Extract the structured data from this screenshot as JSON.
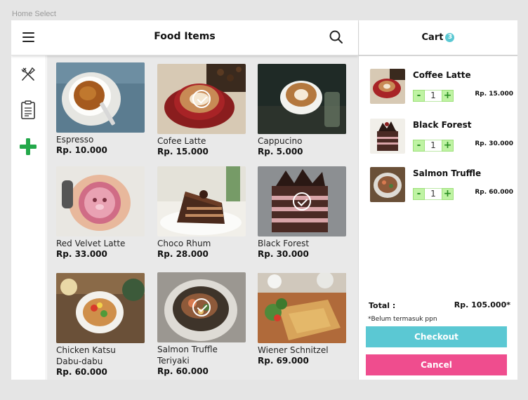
{
  "frame_label": "Home Select",
  "header": {
    "title": "Food Items"
  },
  "sidebar": {
    "items": [
      "utensils-icon",
      "menu-list-icon",
      "add-icon"
    ],
    "accent": "#23a84a"
  },
  "items": [
    {
      "name": "Espresso",
      "price": "Rp. 10.000",
      "selected": false
    },
    {
      "name": "Cofee Latte",
      "price": "Rp. 15.000",
      "selected": true
    },
    {
      "name": "Cappucino",
      "price": "Rp. 5.000",
      "selected": false
    },
    {
      "name": "Red Velvet Latte",
      "price": "Rp. 33.000",
      "selected": false
    },
    {
      "name": "Choco Rhum",
      "price": "Rp. 28.000",
      "selected": false
    },
    {
      "name": "Black Forest",
      "price": "Rp. 30.000",
      "selected": true
    },
    {
      "name": "Chicken Katsu Dabu-dabu",
      "name_lines": [
        "Chicken Katsu",
        "Dabu-dabu"
      ],
      "price": "Rp. 60.000",
      "selected": false
    },
    {
      "name": "Salmon Truffle Teriyaki",
      "name_lines": [
        "Salmon Truffle",
        "Teriyaki"
      ],
      "price": "Rp. 60.000",
      "selected": true
    },
    {
      "name": "Wiener Schnitzel",
      "price": "Rp. 69.000",
      "selected": false
    }
  ],
  "cart": {
    "title": "Cart",
    "count": "3",
    "items": [
      {
        "name": "Coffee Latte",
        "qty": "1",
        "price": "Rp. 15.000"
      },
      {
        "name": "Black Forest",
        "qty": "1",
        "price": "Rp. 30.000"
      },
      {
        "name": "Salmon Truffle",
        "qty": "1",
        "price": "Rp. 60.000"
      }
    ],
    "total_label": "Total :",
    "total_value": "Rp. 105.000*",
    "note": "*Belum termasuk ppn",
    "checkout_label": "Checkout",
    "cancel_label": "Cancel",
    "minus": "-",
    "plus": "+"
  },
  "colors": {
    "checkout": "#5bc8d3",
    "cancel": "#ef4d8e",
    "stepper": "#bff3a3"
  }
}
